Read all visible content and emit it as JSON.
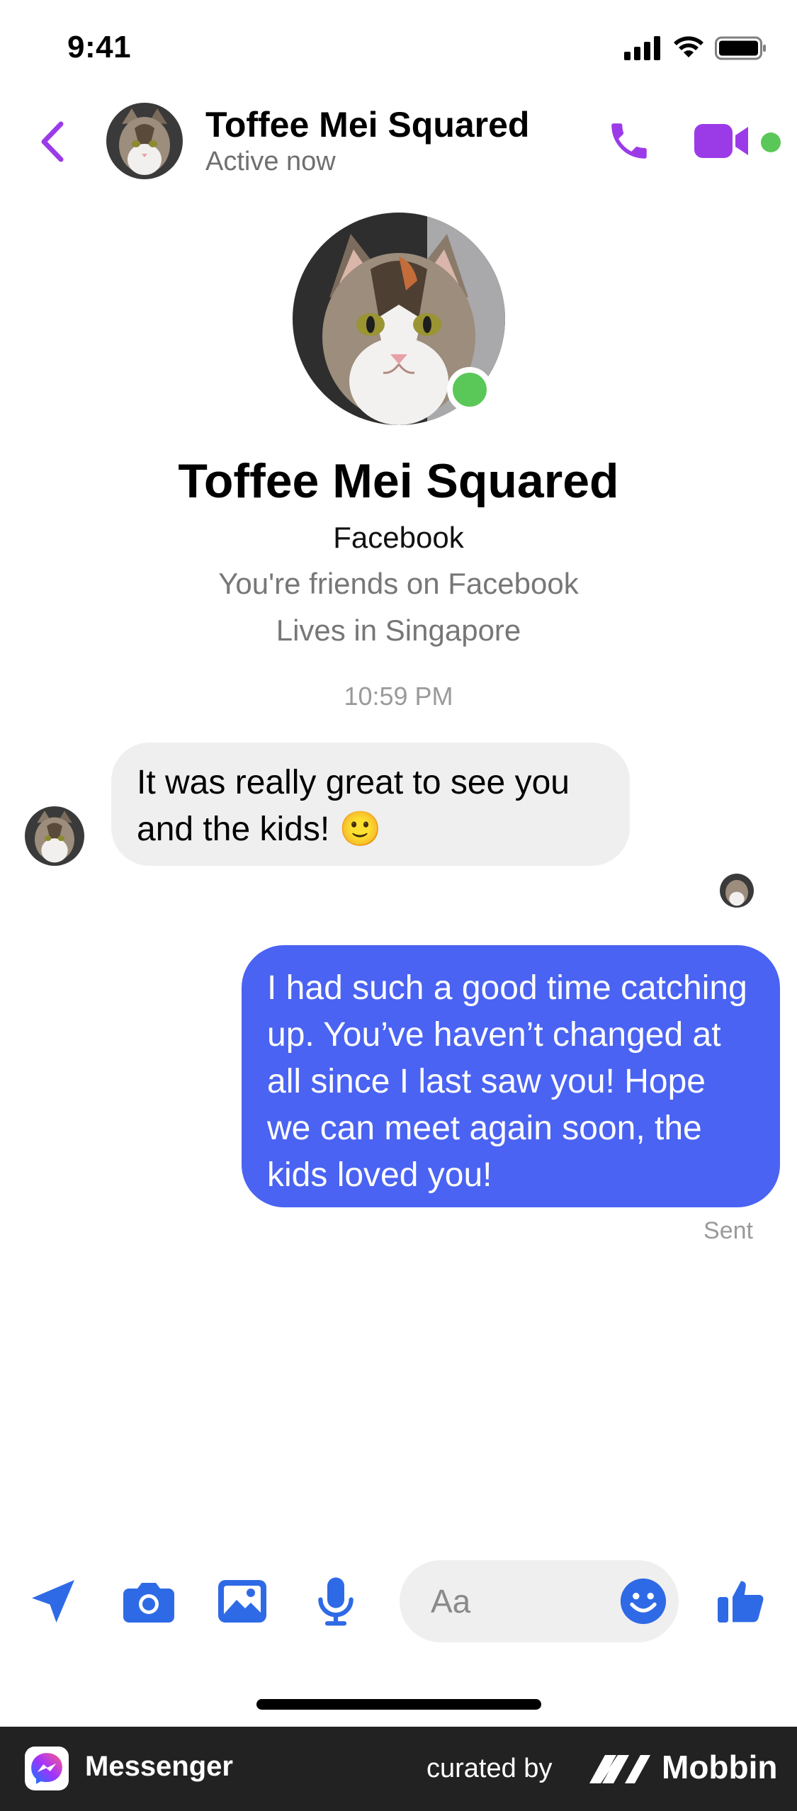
{
  "status_bar": {
    "time": "9:41"
  },
  "header": {
    "name": "Toffee Mei Squared",
    "status": "Active now"
  },
  "profile": {
    "name": "Toffee Mei Squared",
    "source": "Facebook",
    "friends": "You're friends on Facebook",
    "location": "Lives in Singapore"
  },
  "conversation": {
    "timestamp": "10:59 PM",
    "messages": [
      {
        "direction": "incoming",
        "text": "It was really great to see you and the kids! 🙂"
      },
      {
        "direction": "outgoing",
        "text": "I had such a good time catching up. You’ve haven’t changed at all since I last saw you! Hope we can meet again soon, the kids loved you!"
      }
    ],
    "sent_label": "Sent"
  },
  "composer": {
    "placeholder": "Aa"
  },
  "footer": {
    "app_name": "Messenger",
    "curated_by": "curated by",
    "brand": "Mobbin"
  },
  "colors": {
    "accent_purple": "#9b3be8",
    "accent_blue": "#2f6ae6",
    "outgoing_bubble": "#4a63f2",
    "online_green": "#5ac859"
  },
  "icons": [
    "back-icon",
    "phone-icon",
    "video-icon",
    "location-icon",
    "camera-icon",
    "gallery-icon",
    "microphone-icon",
    "emoji-icon",
    "thumbs-up-icon",
    "messenger-logo-icon",
    "mobbin-logo-icon"
  ]
}
